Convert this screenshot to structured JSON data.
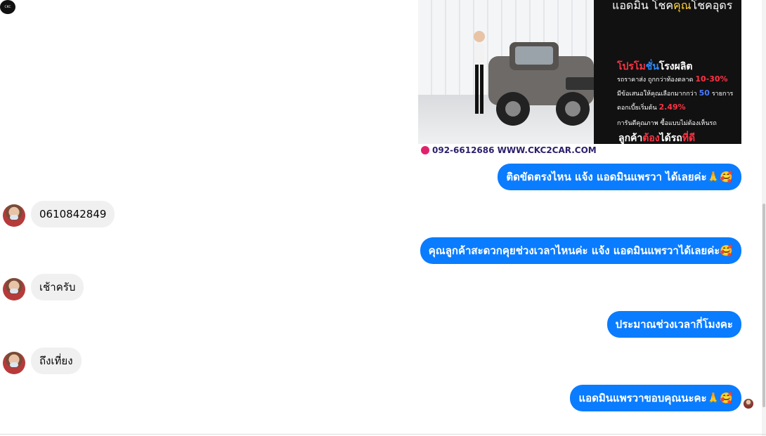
{
  "page_avatar": {
    "label": "CKC"
  },
  "ad_image": {
    "headline_a": "แอดมิน โชค",
    "headline_b": "คุณ",
    "headline_c": "โชคอุดร",
    "promo_title_a": "โปรโม",
    "promo_title_b": "ชั่น",
    "promo_title_c": "โรงผลิต",
    "line1_text": "รถราคาส่ง ถูกกว่าท้องตลาด",
    "line1_value": "10-30%",
    "line2_text": "มีข้อเสนอให้คุณเลือกมากกว่า",
    "line2_value": "50",
    "line2_suffix": "รายการ",
    "line3_text": "ดอกเบี้ยเริ่มต้น",
    "line3_value": "2.49%",
    "line4_text": "การันตีคุณภาพ ซื้อแบบไม่ต้องเห็นรถ",
    "tagline_a": "ลูกค้า",
    "tagline_b": "ต้อง",
    "tagline_c": "ได้รถ",
    "tagline_d": "ที่ดี",
    "contact": "092-6612686  WWW.CKC2CAR.COM"
  },
  "messages": [
    {
      "direction": "out",
      "text": "ติดขัดตรงไหน แจ้ง แอดมินแพรวา ได้เลยค่ะ🙏🥰"
    },
    {
      "direction": "in",
      "text": "0610842849"
    },
    {
      "direction": "out",
      "text": "คุณลูกค้าสะดวกคุยช่วงเวลาไหนค่ะ แจ้ง แอดมินแพรวาได้เลยค่ะ🥰"
    },
    {
      "direction": "in",
      "text": "เช้าครับ"
    },
    {
      "direction": "out",
      "text": "ประมาณช่วงเวลากี่โมงคะ"
    },
    {
      "direction": "in",
      "text": "ถึงเที่ยง"
    },
    {
      "direction": "out",
      "text": "แอดมินแพรวาขอบคุณนะคะ🙏🥰"
    }
  ]
}
